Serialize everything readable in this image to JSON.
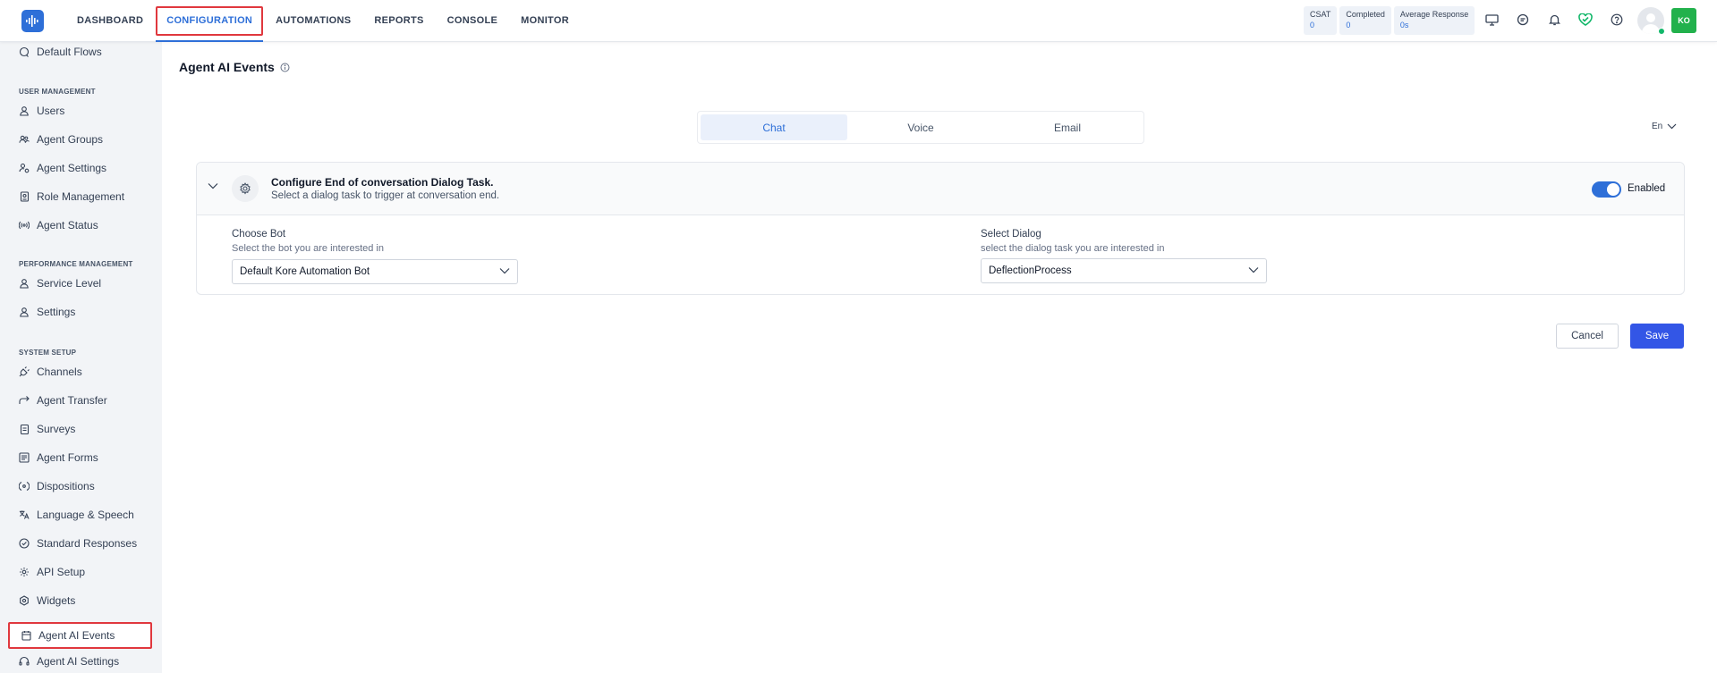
{
  "nav": {
    "items": [
      "DASHBOARD",
      "CONFIGURATION",
      "AUTOMATIONS",
      "REPORTS",
      "CONSOLE",
      "MONITOR"
    ],
    "active": "CONFIGURATION"
  },
  "metrics": [
    {
      "label": "CSAT",
      "value": "0"
    },
    {
      "label": "Completed",
      "value": "0"
    },
    {
      "label": "Average Response",
      "value": "0s"
    }
  ],
  "user": {
    "initials": "KO"
  },
  "sidebar": {
    "default_flows": "Default Flows",
    "sections": {
      "user_management": "USER MANAGEMENT",
      "performance_management": "PERFORMANCE MANAGEMENT",
      "system_setup": "SYSTEM SETUP"
    },
    "user_items": [
      "Users",
      "Agent Groups",
      "Agent Settings",
      "Role Management",
      "Agent Status"
    ],
    "performance_items": [
      "Service Level",
      "Settings"
    ],
    "system_items": [
      "Channels",
      "Agent Transfer",
      "Surveys",
      "Agent Forms",
      "Dispositions",
      "Language & Speech",
      "Standard Responses",
      "API Setup",
      "Widgets",
      "Agent AI Events",
      "Agent AI Settings"
    ],
    "active": "Agent AI Events"
  },
  "page": {
    "title": "Agent AI Events",
    "tabs": [
      "Chat",
      "Voice",
      "Email"
    ],
    "active_tab": "Chat",
    "language": "En"
  },
  "card": {
    "title": "Configure End of conversation Dialog Task.",
    "subtitle": "Select a dialog task to trigger at conversation end.",
    "toggle_label": "Enabled",
    "bot": {
      "label": "Choose Bot",
      "sub": "Select the bot you are interested in",
      "value": "Default Kore Automation Bot"
    },
    "dialog": {
      "label": "Select Dialog",
      "sub": "select the dialog task you are interested in",
      "value": "DeflectionProcess"
    }
  },
  "actions": {
    "cancel": "Cancel",
    "save": "Save"
  },
  "colors": {
    "accent": "#2e6fd8",
    "save": "#3356e6",
    "highlight": "#e0383e",
    "enabled": "#2e6fd8"
  }
}
